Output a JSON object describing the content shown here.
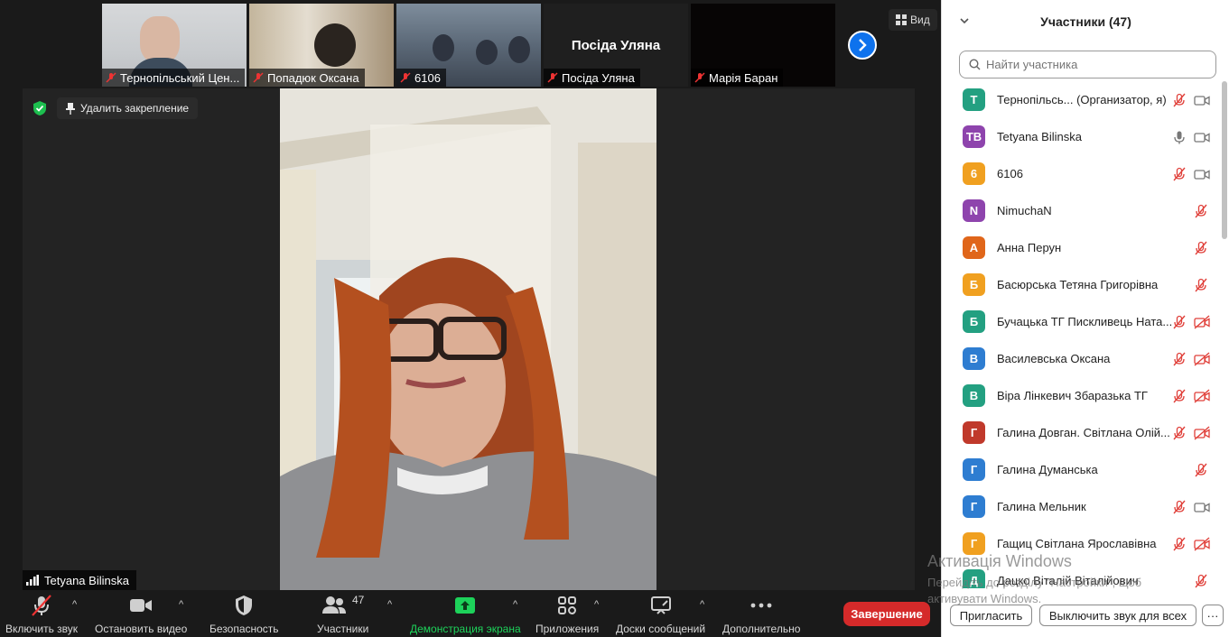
{
  "view_label": "Вид",
  "thumbnails": [
    {
      "name": "Тернопільський Цен...",
      "muted": true,
      "bg": "#cfd3d6"
    },
    {
      "name": "Попадюк Оксана",
      "muted": true,
      "bg": "#b9a88f"
    },
    {
      "name": "6106",
      "muted": true,
      "bg": "#5a6a7c"
    },
    {
      "name": "Посіда Уляна",
      "muted": true,
      "bg": "#2a2a2a",
      "center_name": "Посіда Уляна"
    },
    {
      "name": "Марія Баран",
      "muted": true,
      "bg": "#050505"
    }
  ],
  "main_video": {
    "unpin_label": "Удалить закрепление",
    "speaker_name": "Tetyana Bilinska"
  },
  "toolbar": {
    "unmute": "Включить звук",
    "stop_video": "Остановить видео",
    "security": "Безопасность",
    "participants": "Участники",
    "participants_count": "47",
    "share_screen": "Демонстрация экрана",
    "apps": "Приложения",
    "whiteboards": "Доски сообщений",
    "more": "Дополнительно",
    "end": "Завершение"
  },
  "panel": {
    "title": "Участники (47)",
    "search_placeholder": "Найти участника",
    "invite": "Пригласить",
    "mute_all": "Выключить звук для всех",
    "more": "···",
    "participants": [
      {
        "initials": "Т",
        "name": "Тернопільсь...  (Организатор, я)",
        "color": "#23a081",
        "mic": "muted",
        "cam": "on"
      },
      {
        "initials": "ТВ",
        "name": "Tetyana Bilinska",
        "color": "#8e44ad",
        "mic": "on",
        "cam": "on"
      },
      {
        "initials": "6",
        "name": "6106",
        "color": "#f0a020",
        "mic": "muted",
        "cam": "on"
      },
      {
        "initials": "N",
        "name": "NimuchaN",
        "color": "#8e44ad",
        "mic": "muted",
        "cam": "none"
      },
      {
        "initials": "А",
        "name": "Анна Перун",
        "color": "#e0661a",
        "mic": "muted",
        "cam": "none"
      },
      {
        "initials": "Б",
        "name": "Басюрська Тетяна Григорівна",
        "color": "#f0a020",
        "mic": "muted",
        "cam": "none"
      },
      {
        "initials": "Б",
        "name": "Бучацька ТГ Пискливець Ната...",
        "color": "#23a081",
        "mic": "muted",
        "cam": "off"
      },
      {
        "initials": "В",
        "name": "Василевська Оксана",
        "color": "#2e7dd1",
        "mic": "muted",
        "cam": "off"
      },
      {
        "initials": "В",
        "name": "Віра Лінкевич Збаразька ТГ",
        "color": "#23a081",
        "mic": "muted",
        "cam": "off"
      },
      {
        "initials": "Г",
        "name": "Галина Довган. Світлана Олій...",
        "color": "#c0392b",
        "mic": "muted",
        "cam": "off"
      },
      {
        "initials": "Г",
        "name": "Галина Думанська",
        "color": "#2e7dd1",
        "mic": "muted",
        "cam": "none"
      },
      {
        "initials": "Г",
        "name": "Галина Мельник",
        "color": "#2e7dd1",
        "mic": "muted",
        "cam": "on"
      },
      {
        "initials": "Г",
        "name": "Гащиц Світлана Ярославівна",
        "color": "#f0a020",
        "mic": "muted",
        "cam": "off"
      },
      {
        "initials": "Д",
        "name": "Дацко Віталій Віталійович",
        "color": "#23a081",
        "mic": "muted",
        "cam": "none"
      }
    ]
  },
  "activation": {
    "title": "Активація Windows",
    "line1": "Перейдіть до розділу \"Настройки\", щоб",
    "line2": "активувати Windows."
  }
}
